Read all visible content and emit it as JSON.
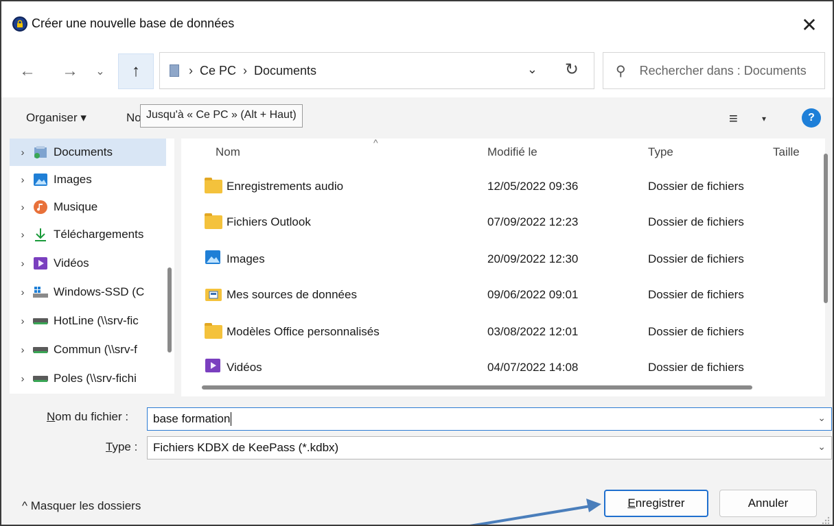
{
  "window": {
    "title": "Créer une nouvelle base de données",
    "close_glyph": "✕"
  },
  "nav": {
    "back_glyph": "←",
    "forward_glyph": "→",
    "recent_glyph": "⌄",
    "up_glyph": "↑",
    "breadcrumb": [
      "Ce PC",
      "Documents"
    ],
    "crumb_sep": "›",
    "dropdown_glyph": "⌄",
    "refresh_glyph": "↻",
    "search_placeholder": "Rechercher dans : Documents"
  },
  "toolbar": {
    "organiser": "Organiser ▾",
    "nouveau": "No",
    "tooltip": "Jusqu'à « Ce PC » (Alt + Haut)",
    "view_glyph": "≡",
    "view_dd": "▾",
    "help": "?"
  },
  "tree": [
    {
      "label": "Documents",
      "icon": "documents-icon",
      "selected": true
    },
    {
      "label": "Images",
      "icon": "images-icon"
    },
    {
      "label": "Musique",
      "icon": "music-icon"
    },
    {
      "label": "Téléchargements",
      "icon": "download-icon"
    },
    {
      "label": "Vidéos",
      "icon": "video-icon"
    },
    {
      "label": "Windows-SSD (C",
      "icon": "drive-icon"
    },
    {
      "label": "HotLine (\\\\srv-fic",
      "icon": "network-drive-icon"
    },
    {
      "label": "Commun (\\\\srv-f",
      "icon": "network-drive-icon"
    },
    {
      "label": "Poles (\\\\srv-fichi",
      "icon": "network-drive-icon"
    }
  ],
  "tree_chevron": "›",
  "columns": {
    "name": "Nom",
    "modified": "Modifié le",
    "type": "Type",
    "size": "Taille",
    "sort_glyph": "^"
  },
  "files": [
    {
      "name": "Enregistrements audio",
      "modified": "12/05/2022 09:36",
      "type": "Dossier de fichiers",
      "icon": "folder-icon"
    },
    {
      "name": "Fichiers Outlook",
      "modified": "07/09/2022 12:23",
      "type": "Dossier de fichiers",
      "icon": "folder-icon"
    },
    {
      "name": "Images",
      "modified": "20/09/2022 12:30",
      "type": "Dossier de fichiers",
      "icon": "images-folder-icon"
    },
    {
      "name": "Mes sources de données",
      "modified": "09/06/2022 09:01",
      "type": "Dossier de fichiers",
      "icon": "data-sources-folder-icon"
    },
    {
      "name": "Modèles Office personnalisés",
      "modified": "03/08/2022 12:01",
      "type": "Dossier de fichiers",
      "icon": "folder-icon"
    },
    {
      "name": "Vidéos",
      "modified": "04/07/2022 14:08",
      "type": "Dossier de fichiers",
      "icon": "videos-folder-icon"
    }
  ],
  "form": {
    "filename_label_u": "N",
    "filename_label_rest": "om du fichier :",
    "filename_value": "base formation",
    "type_label_u": "T",
    "type_label_rest": "ype :",
    "type_value": "Fichiers KDBX de KeePass (*.kdbx)",
    "dropdown_glyph": "⌄"
  },
  "footer": {
    "hide_folders": "^ Masquer les dossiers",
    "save_u": "E",
    "save_rest": "nregistrer",
    "cancel": "Annuler"
  },
  "colors": {
    "accent": "#1f6fce",
    "annotation_arrow": "#4a7ebb",
    "folder": "#f4c23c"
  }
}
